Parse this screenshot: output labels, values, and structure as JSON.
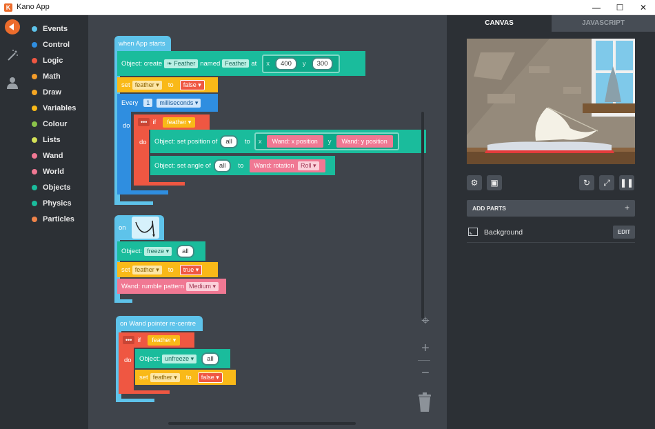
{
  "window": {
    "title": "Kano App",
    "minimize": "—",
    "maximize": "☐",
    "close": "✕"
  },
  "rail": {
    "icons": [
      "kano-logo-icon",
      "wand-icon",
      "user-icon"
    ]
  },
  "categories": [
    {
      "label": "Events",
      "color": "#5ec3ea"
    },
    {
      "label": "Control",
      "color": "#2f8ee0"
    },
    {
      "label": "Logic",
      "color": "#ef5742"
    },
    {
      "label": "Math",
      "color": "#f39c2a"
    },
    {
      "label": "Draw",
      "color": "#f5a623"
    },
    {
      "label": "Variables",
      "color": "#f9b918"
    },
    {
      "label": "Colour",
      "color": "#8bc34a"
    },
    {
      "label": "Lists",
      "color": "#d4e157"
    },
    {
      "label": "Wand",
      "color": "#f07893"
    },
    {
      "label": "World",
      "color": "#f07893"
    },
    {
      "label": "Objects",
      "color": "#1abc9c"
    },
    {
      "label": "Physics",
      "color": "#1abc9c"
    },
    {
      "label": "Particles",
      "color": "#f0844a"
    }
  ],
  "blocks": {
    "when_app_starts": "when App starts",
    "object_create": "Object: create",
    "feather_obj": "Feather",
    "named": "named",
    "feather_name": "Feather",
    "at": "at",
    "x": "x",
    "x_val": "400",
    "y": "y",
    "y_val": "300",
    "set": "set",
    "var_feather": "feather",
    "to": "to",
    "false": "false",
    "every": "Every",
    "every_val": "1",
    "milliseconds": "milliseconds",
    "do": "do",
    "if": "if",
    "set_position": "Object: set position of",
    "all": "all",
    "wand_x": "Wand: x position",
    "wand_y": "Wand: y position",
    "set_angle": "Object: set angle of",
    "wand_rotation": "Wand: rotation",
    "roll": "Roll",
    "on": "on",
    "object": "Object:",
    "freeze": "freeze",
    "true": "true",
    "rumble": "Wand: rumble pattern",
    "medium": "Medium",
    "on_wand_recentre": "on Wand pointer re-centre",
    "unfreeze": "unfreeze",
    "dots": "•••"
  },
  "workspace": {
    "target_icon": "⌖",
    "zoom_in": "+",
    "zoom_out": "−"
  },
  "panel": {
    "tab_canvas": "CANVAS",
    "tab_js": "JAVASCRIPT",
    "add_parts": "ADD PARTS",
    "add_plus": "+",
    "part_name": "Background",
    "edit": "EDIT"
  },
  "colors": {
    "accent": "#ec6c2c",
    "bg": "#3f444b",
    "dark": "#2c3035"
  }
}
